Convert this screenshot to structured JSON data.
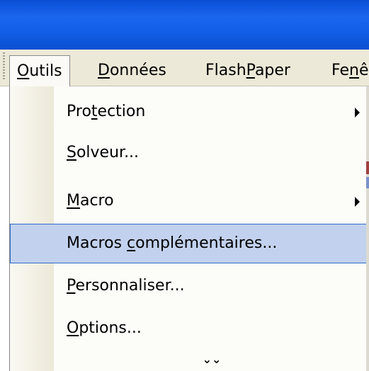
{
  "menubar": {
    "items": [
      {
        "label": "Outils",
        "underline_index": 0
      },
      {
        "label": "Données",
        "underline_index": 0
      },
      {
        "label": "FlashPaper",
        "underline_index": 5
      },
      {
        "label": "Fenê",
        "underline_index": 2
      }
    ]
  },
  "dropdown": {
    "items": [
      {
        "label": "Protection",
        "underline_index": 3,
        "submenu": true
      },
      {
        "label": "Solveur...",
        "underline_index": 0,
        "submenu": false
      },
      {
        "label": "Macro",
        "underline_index": 0,
        "submenu": true
      },
      {
        "label": "Macros complémentaires...",
        "underline_index": 7,
        "submenu": false,
        "highlighted": true
      },
      {
        "label": "Personnaliser...",
        "underline_index": 0,
        "submenu": false
      },
      {
        "label": "Options...",
        "underline_index": 0,
        "submenu": false
      }
    ],
    "expand_glyph": "⌄⌄"
  },
  "colors": {
    "titlebar": "#1360e8",
    "menubar": "#ece9d8",
    "highlight_bg": "#c2d2ee",
    "highlight_border": "#316ac5"
  }
}
